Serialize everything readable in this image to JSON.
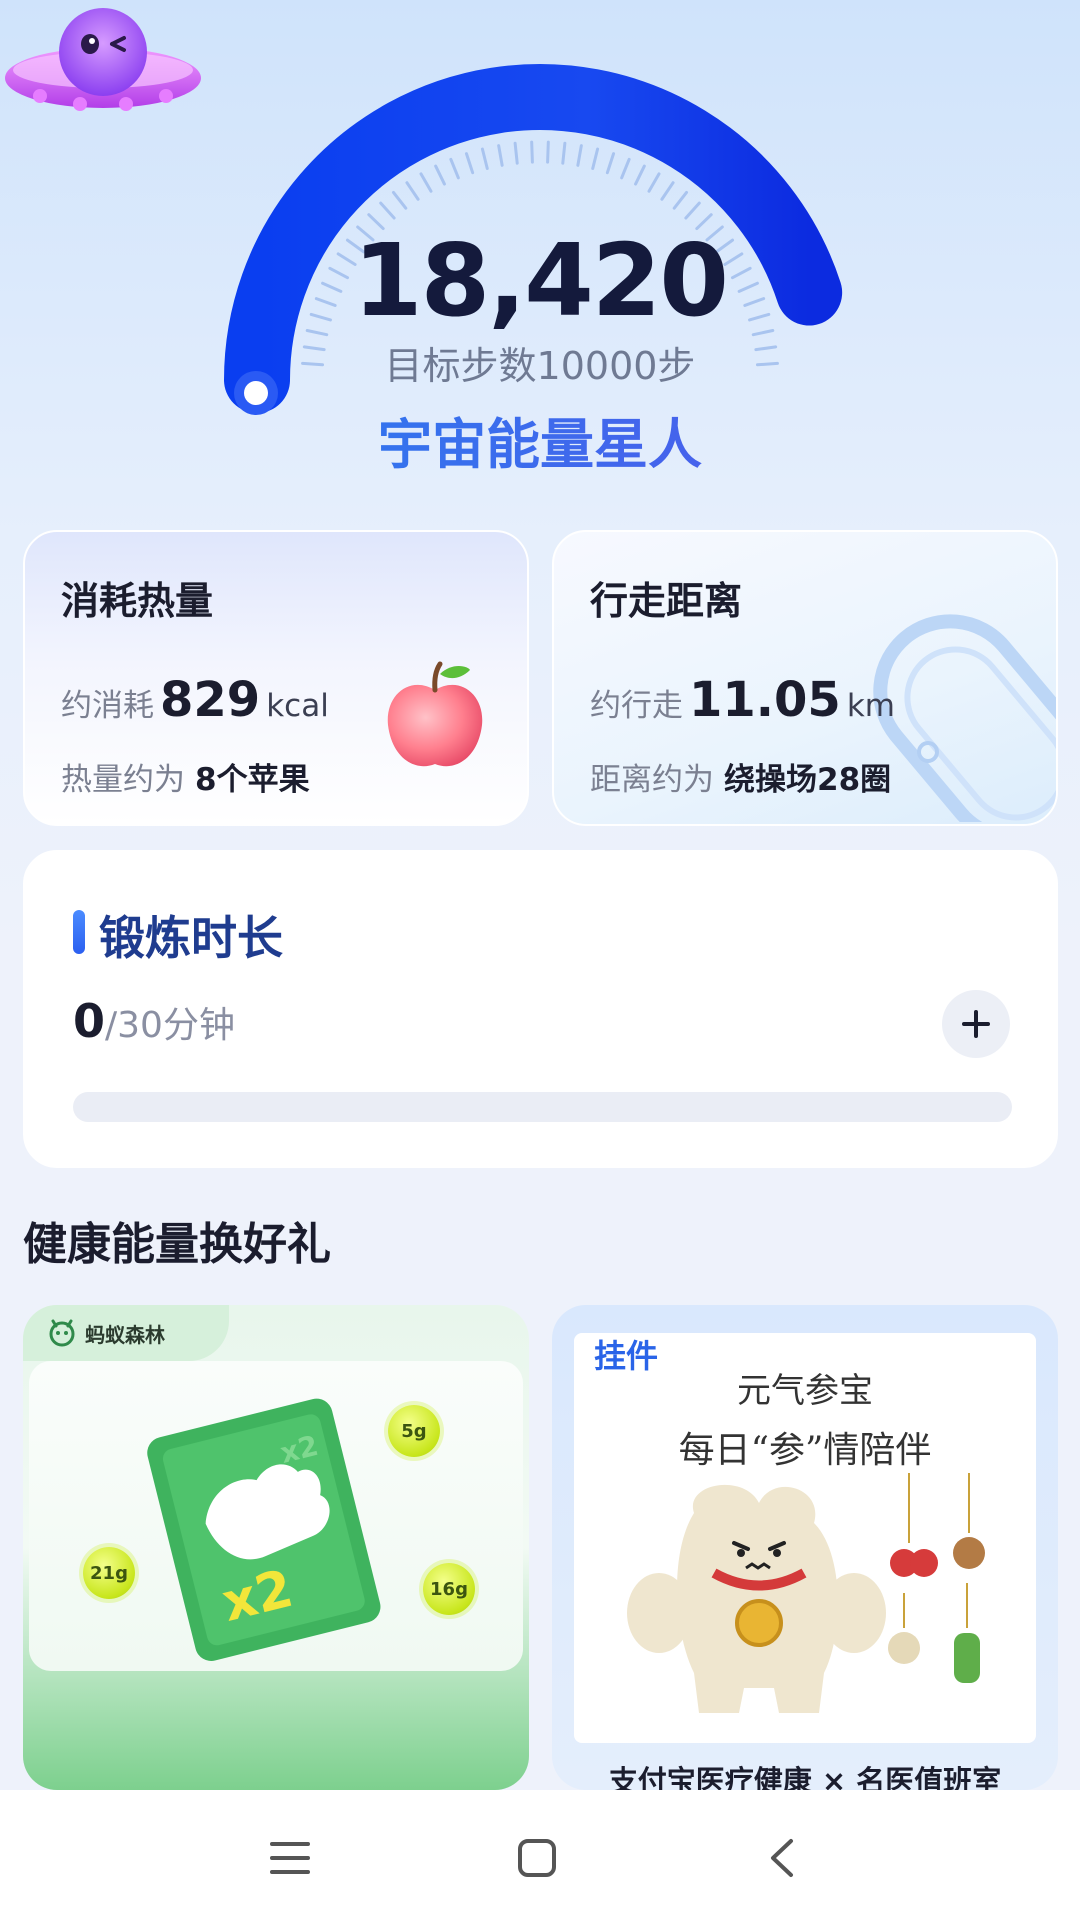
{
  "steps": {
    "value": "18,420",
    "goal_label": "目标步数10000步",
    "progress": 1.0,
    "level_title": "宇宙能量星人"
  },
  "calories": {
    "title": "消耗热量",
    "prefix": "约消耗",
    "value": "829",
    "unit": "kcal",
    "equiv_prefix": "热量约为",
    "equiv_value": "8个苹果"
  },
  "distance": {
    "title": "行走距离",
    "prefix": "约行走",
    "value": "11.05",
    "unit": "km",
    "equiv_prefix": "距离约为",
    "equiv_value": "绕操场28圈"
  },
  "exercise": {
    "title": "锻炼时长",
    "current": "0",
    "total_label": "/30分钟",
    "progress": 0.0,
    "add_icon": "plus-icon"
  },
  "gifts": {
    "section_title": "健康能量换好礼",
    "forest": {
      "brand": "蚂蚁森林",
      "bubbles": [
        "5g",
        "21g",
        "16g"
      ],
      "card_mark": "x2"
    },
    "pendant": {
      "tag": "挂件",
      "headline_1": "元气参宝",
      "headline_2": "每日“参”情陪伴",
      "caption": "支付宝医疗健康 × 名医值班室"
    }
  },
  "navbar": {
    "items": [
      "menu-icon",
      "home-icon",
      "back-icon"
    ]
  },
  "colors": {
    "accent_blue": "#1a4fe8",
    "gauge_start": "#0a3ef0",
    "title_gradient_start": "#1f86f0",
    "title_gradient_end": "#5b4fe9"
  }
}
